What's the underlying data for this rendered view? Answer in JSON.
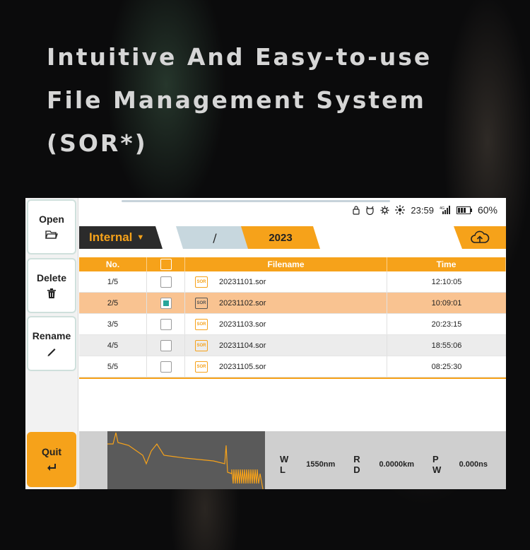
{
  "headline": {
    "line1": "Intuitive And Easy-to-use",
    "line2": "File Management System",
    "line3": "(SOR*)"
  },
  "sidebar": {
    "open_label": "Open",
    "delete_label": "Delete",
    "rename_label": "Rename",
    "quit_label": "Quit"
  },
  "status": {
    "time": "23:59",
    "battery": "60%",
    "icons": [
      "lock-icon",
      "usb-icon",
      "settings-icon",
      "brightness-icon",
      "signal-icon",
      "battery-icon"
    ]
  },
  "path": {
    "storage": "Internal",
    "root": "/",
    "folder": "2023"
  },
  "table": {
    "headers": {
      "no": "No.",
      "filename": "Filename",
      "time": "Time"
    },
    "rows": [
      {
        "no": "1/5",
        "filename": "20231101.sor",
        "time": "12:10:05",
        "checked": false
      },
      {
        "no": "2/5",
        "filename": "20231102.sor",
        "time": "10:09:01",
        "checked": true
      },
      {
        "no": "3/5",
        "filename": "20231103.sor",
        "time": "20:23:15",
        "checked": false
      },
      {
        "no": "4/5",
        "filename": "20231104.sor",
        "time": "18:55:06",
        "checked": false
      },
      {
        "no": "5/5",
        "filename": "20231105.sor",
        "time": "08:25:30",
        "checked": false
      }
    ],
    "file_icon_text": "SOR"
  },
  "trace": {
    "wl_label": "W L",
    "wl_value": "1550nm",
    "rd_label": "R D",
    "rd_value": "0.0000km",
    "pw_label": "P W",
    "pw_value": "0.000ns"
  },
  "colors": {
    "accent": "#f6a21a",
    "selected_row": "#f9c391",
    "check_mark": "#26a69a",
    "dark_tab": "#2b2b2b",
    "path_root": "#c7d7de"
  }
}
